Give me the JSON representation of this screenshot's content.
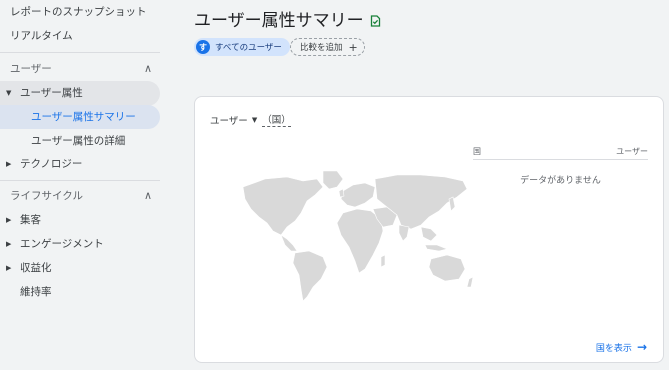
{
  "sidebar": {
    "report_snapshot": "レポートのスナップショット",
    "realtime": "リアルタイム",
    "sections": [
      {
        "label": "ユーザー",
        "chevron": "∧"
      },
      {
        "label": "ライフサイクル",
        "chevron": "∧"
      }
    ],
    "user_items": {
      "attributes_group": "ユーザー属性",
      "attributes_summary": "ユーザー属性サマリー",
      "attributes_detail": "ユーザー属性の詳細",
      "technology": "テクノロジー"
    },
    "lifecycle_items": {
      "acquisition": "集客",
      "engagement": "エンゲージメント",
      "monetization": "収益化",
      "retention": "維持率"
    }
  },
  "header": {
    "title": "ユーザー属性サマリー",
    "title_icon": "doc-check-icon"
  },
  "chips": {
    "segment_avatar": "す",
    "segment_label": "すべてのユーザー",
    "compare_label": "比較を追加",
    "compare_icon": "+"
  },
  "card": {
    "metric": "ユーザー",
    "dimension": "（国）",
    "table_headers": {
      "left": "国",
      "right": "ユーザー"
    },
    "empty_message": "データがありません",
    "view_link": "国を表示",
    "map_icon": "world-map"
  },
  "colors": {
    "accent": "#1a73e8",
    "active_bg": "#dbe3f0",
    "map_fill": "#d9d9d9",
    "page_bg": "#f1f3f4",
    "check_icon": "#188038"
  }
}
